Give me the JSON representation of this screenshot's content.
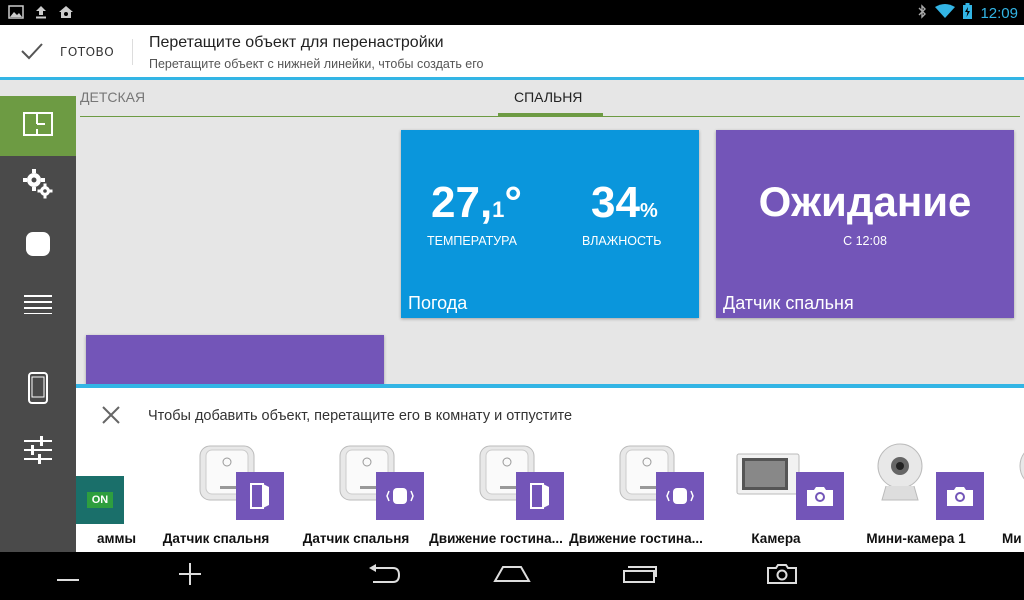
{
  "status_bar": {
    "time": "12:09"
  },
  "action_bar": {
    "done_label": "ГОТОВО",
    "title": "Перетащите объект для перенастройки",
    "subtitle": "Перетащите объект с нижней линейки, чтобы создать его"
  },
  "tabs": [
    {
      "label": "ДЕТСКАЯ"
    },
    {
      "label": "СПАЛЬНЯ"
    }
  ],
  "weather_tile": {
    "temp_main": "27,",
    "temp_frac": "1",
    "temp_unit": "°",
    "temp_caption": "ТЕМПЕРАТУРА",
    "humidity": "34",
    "humidity_unit": "%",
    "humidity_caption": "ВЛАЖНОСТЬ",
    "label": "Погода"
  },
  "sensor_tile": {
    "state": "Ожидание",
    "since": "С 12:08",
    "label": "Датчик спальня"
  },
  "drawer": {
    "hint": "Чтобы добавить объект, перетащите его в комнату и отпустите",
    "on_badge": "ON",
    "widgets": [
      {
        "label": "аммы"
      },
      {
        "label": "Датчик спальня"
      },
      {
        "label": "Датчик спальня"
      },
      {
        "label": "Движение гостина..."
      },
      {
        "label": "Движение гостина..."
      },
      {
        "label": "Камера"
      },
      {
        "label": "Мини-камера 1"
      },
      {
        "label": "Ми"
      }
    ]
  },
  "colors": {
    "accent_blue": "#33b5e5",
    "green": "#6d9b43",
    "tile_blue": "#0a96dc",
    "tile_purple": "#7355b8"
  }
}
